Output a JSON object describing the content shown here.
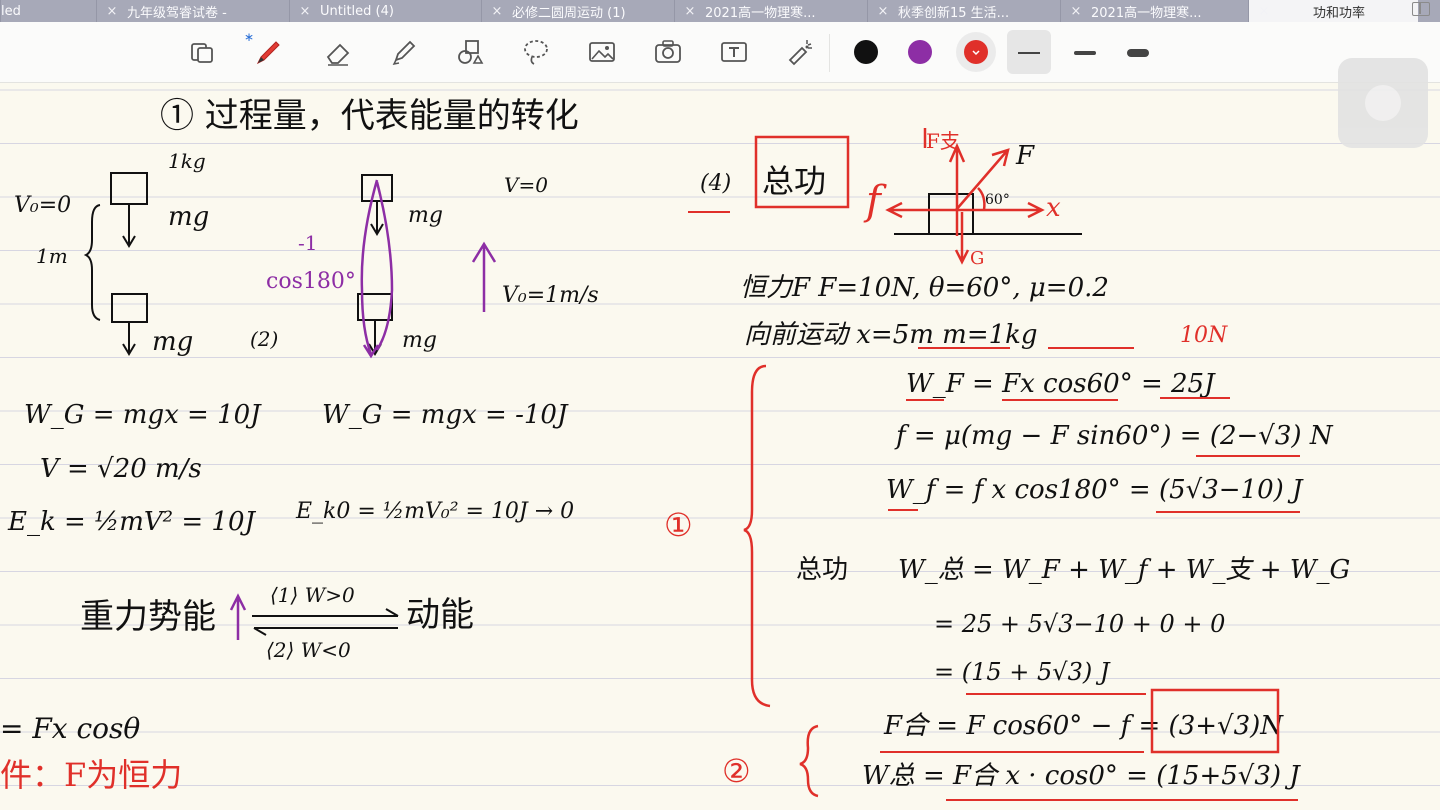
{
  "tabs": [
    {
      "title": "led",
      "active": false
    },
    {
      "title": "九年级驾睿试卷 -",
      "active": false
    },
    {
      "title": "Untitled (4)",
      "active": false
    },
    {
      "title": "必修二圆周运动 (1)",
      "active": false
    },
    {
      "title": "2021高一物理寒...",
      "active": false
    },
    {
      "title": "秋季创新15 生活...",
      "active": false
    },
    {
      "title": "2021高一物理寒...",
      "active": false
    },
    {
      "title": "功和功率",
      "active": true
    }
  ],
  "toolbar": {
    "tools": [
      "page-layout",
      "pen",
      "eraser",
      "highlighter",
      "shapes",
      "lasso",
      "image",
      "camera",
      "text",
      "laser-pointer"
    ],
    "bluetooth_mark": "∗",
    "colors": [
      "#111111",
      "#8d2ea5",
      "#e0302a"
    ],
    "selected_color": "#e0302a",
    "stroke_weights": [
      "thin",
      "medium",
      "thick"
    ],
    "selected_weight": "thin"
  },
  "notes": {
    "heading": "① 过程量，代表能量的转化",
    "left": {
      "v0": "V₀=0",
      "length": "1m",
      "mass": "1kg",
      "force_top": "mg",
      "force_bottom": "mg",
      "work_gravity": "W_G = mgx = 10J",
      "velocity": "V = √20 m/s",
      "kinetic": "E_k = ½mV² = 10J"
    },
    "middle": {
      "label": "(2)",
      "v": "V=0",
      "v0": "V₀=1m/s",
      "cos": "cos180°",
      "cos_value": "-1",
      "force_top": "mg",
      "force_bottom": "mg",
      "work_gravity": "W_G = mgx = -10J",
      "kinetic": "E_k0 = ½mV₀² = 10J → 0"
    },
    "conversion": {
      "left": "重力势能",
      "right": "动能",
      "top_arrow": "⟨1⟩ W>0",
      "bottom_arrow": "⟨2⟩ W<0"
    },
    "formula": "= Fx cosθ",
    "condition": "件：F为恒力",
    "right": {
      "part": "(4)",
      "title": "总功",
      "given_1": "恒力F   F=10N, θ=60°, μ=0.2",
      "given_2": "向前运动 x=5m   m=1kg",
      "side_note": "10N",
      "step_1": "W_F = Fx cos60° = 25J",
      "step_2": "f = μ(mg − F sin60°) = (2−√3) N",
      "step_3": "W_f = f x cos180° = (5√3−10) J",
      "marker_1": "①",
      "total_label": "总功",
      "total_1": "W_总 = W_F + W_f + W_支 + W_G",
      "total_2": "= 25 + 5√3−10 + 0 + 0",
      "total_3": "= (15 + 5√3) J",
      "net_force": "F合 = F cos60° − f = (3+√3)N",
      "marker_2": "②",
      "net_work": "W总 = F合 x · cos0° = (15+5√3) J",
      "diagram": {
        "support": "F支",
        "applied": "F",
        "friction": "f",
        "axis": "x",
        "gravity": "G",
        "angle": "60°"
      }
    }
  }
}
